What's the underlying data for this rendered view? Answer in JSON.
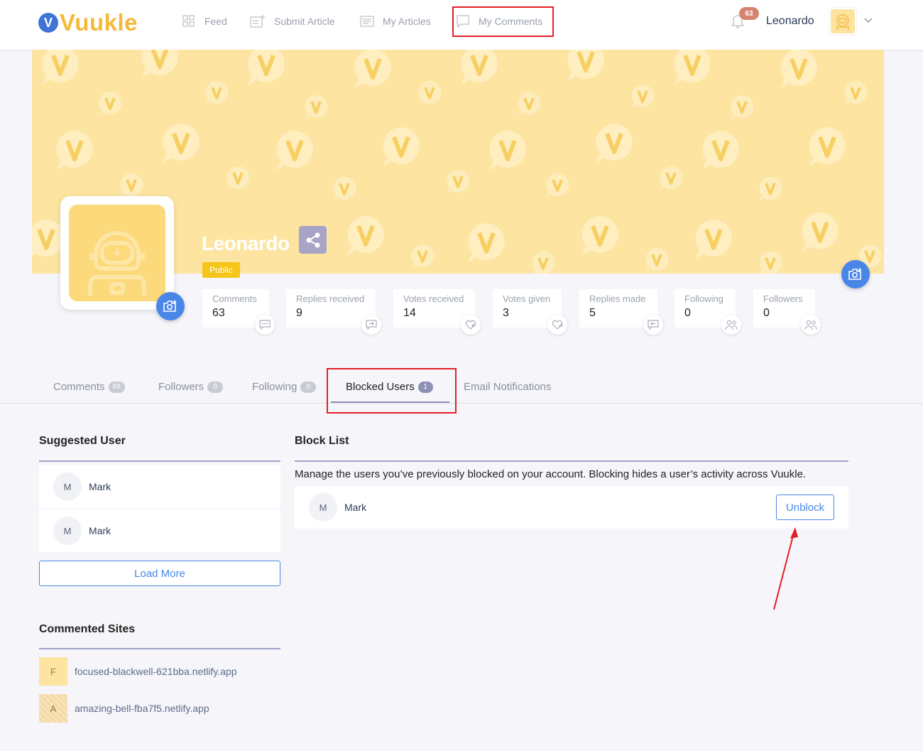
{
  "brand": {
    "logo_letter": "V",
    "name": "Vuukle"
  },
  "nav": {
    "items": [
      {
        "label": "Feed",
        "icon": "grid-icon"
      },
      {
        "label": "Submit Article",
        "icon": "edit-doc-icon"
      },
      {
        "label": "My Articles",
        "icon": "article-icon"
      },
      {
        "label": "My Comments",
        "icon": "comment-icon"
      }
    ],
    "notification_count": "63",
    "username": "Leonardo"
  },
  "profile": {
    "name": "Leonardo",
    "visibility": "Public",
    "stats": [
      {
        "label": "Comments",
        "value": "63"
      },
      {
        "label": "Replies received",
        "value": "9"
      },
      {
        "label": "Votes received",
        "value": "14"
      },
      {
        "label": "Votes given",
        "value": "3"
      },
      {
        "label": "Replies made",
        "value": "5"
      },
      {
        "label": "Following",
        "value": "0"
      },
      {
        "label": "Followers",
        "value": "0"
      }
    ]
  },
  "tabs": [
    {
      "label": "Comments",
      "count": "68"
    },
    {
      "label": "Followers",
      "count": "0"
    },
    {
      "label": "Following",
      "count": "0"
    },
    {
      "label": "Blocked Users",
      "count": "1"
    },
    {
      "label": "Email Notifications",
      "count": ""
    }
  ],
  "suggested": {
    "title": "Suggested User",
    "users": [
      {
        "initial": "M",
        "name": "Mark"
      },
      {
        "initial": "M",
        "name": "Mark"
      }
    ],
    "load_more": "Load More"
  },
  "sites": {
    "title": "Commented Sites",
    "items": [
      {
        "initial": "F",
        "name": "focused-blackwell-621bba.netlify.app"
      },
      {
        "initial": "A",
        "name": "amazing-bell-fba7f5.netlify.app"
      }
    ]
  },
  "block_list": {
    "title": "Block List",
    "description": "Manage the users you’ve previously blocked on your account. Blocking hides a user’s activity across Vuukle.",
    "users": [
      {
        "initial": "M",
        "name": "Mark",
        "action": "Unblock"
      }
    ]
  },
  "colors": {
    "accent": "#4a86e8",
    "brand_yellow": "#f4b93a",
    "highlight": "#e41e26"
  }
}
